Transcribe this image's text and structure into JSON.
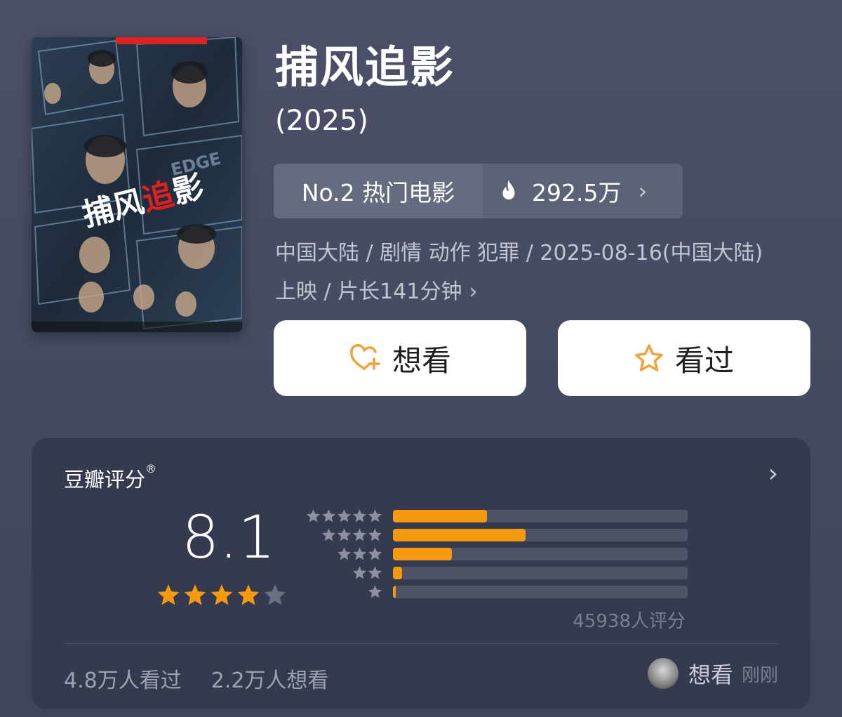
{
  "movie": {
    "title": "捕风追影",
    "year": "(2025)"
  },
  "rank": {
    "label": "No.2 热门电影",
    "heat": "292.5万",
    "chevron": "›"
  },
  "meta": {
    "line1": "中国大陆 / 剧情 动作 犯罪 / 2025-08-16(中国大陆)",
    "line2": "上映 / 片长141分钟",
    "arrow": "›"
  },
  "actions": {
    "want_label": "想看",
    "seen_label": "看过"
  },
  "rating": {
    "title": "豆瓣评分",
    "registered_mark": "®",
    "chevron": "›",
    "score": "8.1",
    "stars_filled": 4,
    "stars_total": 5,
    "distribution": [
      {
        "stars": 5,
        "fraction": 0.32
      },
      {
        "stars": 4,
        "fraction": 0.45
      },
      {
        "stars": 3,
        "fraction": 0.2
      },
      {
        "stars": 2,
        "fraction": 0.03
      },
      {
        "stars": 1,
        "fraction": 0.01
      }
    ],
    "raters": "45938人评分"
  },
  "footer": {
    "seen_count": "4.8万人看过",
    "want_count": "2.2万人想看",
    "friend_action": "想看",
    "friend_time": "刚刚"
  },
  "colors": {
    "accent": "#f59a0f",
    "card_bg": "#353a4e",
    "page_bg": "#474c63"
  },
  "icons": {
    "heart_plus": "heart-plus-icon",
    "star_outline": "star-outline-icon",
    "fire": "fire-icon"
  }
}
